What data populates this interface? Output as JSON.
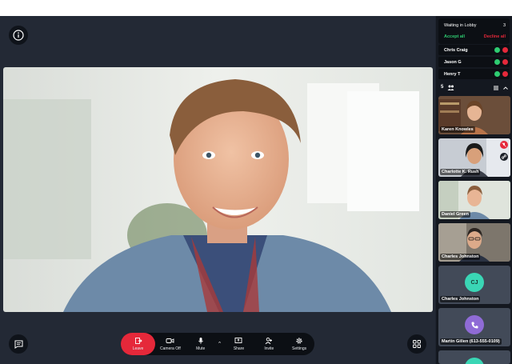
{
  "toolbar": {
    "leave": "Leave",
    "camera": "Camera Off",
    "mute": "Mute",
    "share": "Share",
    "invite": "Invite",
    "settings": "Settings"
  },
  "lobby": {
    "title": "Waiting in Lobby",
    "count": "3",
    "accept_all": "Accept all",
    "decline_all": "Decline all",
    "people": [
      "Chris Craig",
      "Jason G",
      "Henry T"
    ]
  },
  "participants_count": "5",
  "tiles": [
    {
      "name": "Karen Knowles"
    },
    {
      "name": "Charlotte K. Rush"
    },
    {
      "name": "Daniel Green"
    },
    {
      "name": "Charles Johnston"
    },
    {
      "name": "Charles Johnston",
      "initials": "CJ"
    },
    {
      "name": "Martin Gillen (613-555-0109)"
    }
  ],
  "colors": {
    "leave": "#e5283a",
    "accept": "#2ecc71",
    "decline": "#e5283a",
    "active_border": "#3bb36d",
    "cj_avatar": "#3ad6b5",
    "phone_avatar": "#8f6bd6"
  }
}
